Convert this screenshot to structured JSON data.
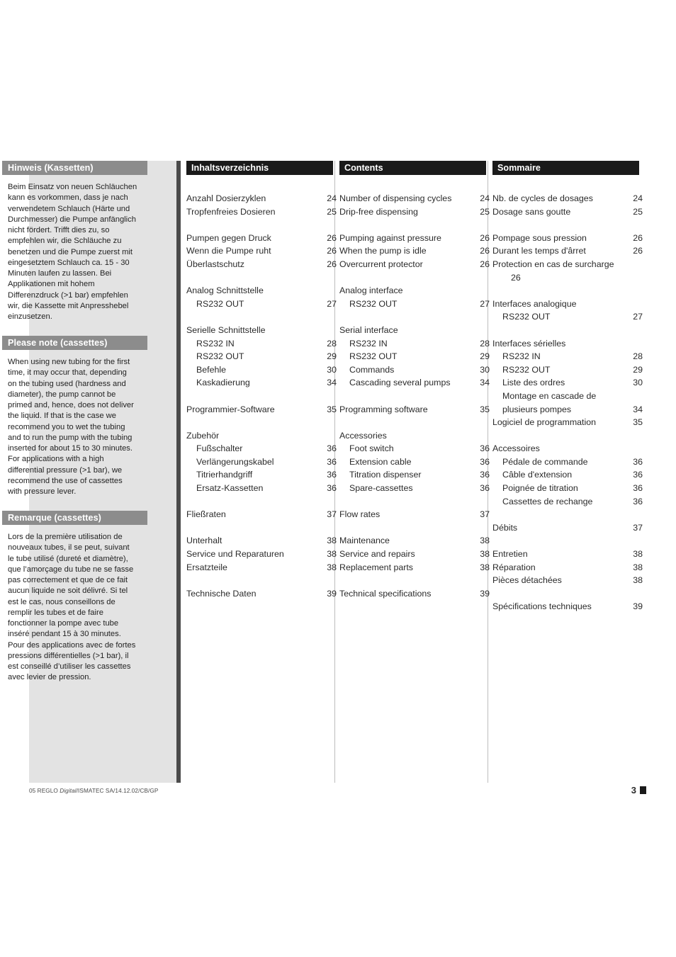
{
  "notes": [
    {
      "heading": "Hinweis (Kassetten)",
      "body": "Beim Einsatz von neuen Schläuchen kann es vorkommen, dass je nach verwendetem Schlauch (Härte und Durchmesser) die Pumpe anfänglich nicht fördert. Trifft dies zu, so empfehlen wir, die Schläuche zu benetzen und die Pumpe zuerst mit eingesetztem Schlauch ca. 15 - 30 Minuten laufen zu lassen. Bei Applikationen mit hohem Differenzdruck (>1 bar) empfehlen wir, die Kassette mit Anpresshebel einzusetzen."
    },
    {
      "heading": "Please note (cassettes)",
      "body": "When using new tubing for the first time, it may occur that, depending on the tubing used (hardness and diameter), the pump cannot be primed and, hence, does not deliver the liquid. If that is the case we recommend you to wet the tubing and to run the pump with the tubing inserted for about 15 to 30 minutes. For applications with a high differential pressure (>1 bar), we recommend the use of cassettes with pressure lever."
    },
    {
      "heading": "Remarque (cassettes)",
      "body": "Lors de la première utilisation de nouveaux tubes, il se peut, suivant le tube utilisé (dureté et diamètre), que l’amorçage du tube ne se fasse pas correctement et que de ce fait aucun liquide ne soit délivré. Si tel est le cas, nous conseillons de remplir les tubes et de faire fonctionner la pompe avec tube inséré pendant 15 à 30 minutes. Pour des applications avec de fortes pressions différentielles (>1 bar), il est conseillé d’utiliser les cassettes avec levier de pression."
    }
  ],
  "toc_de": {
    "heading": "Inhaltsverzeichnis",
    "rows": [
      {
        "label": "Anzahl Dosierzyklen",
        "page": "24",
        "indent": 0
      },
      {
        "label": "Tropfenfreies Dosieren",
        "page": "25",
        "indent": 0
      },
      {
        "gap": true
      },
      {
        "label": "Pumpen gegen Druck",
        "page": "26",
        "indent": 0
      },
      {
        "label": "Wenn die Pumpe ruht",
        "page": "26",
        "indent": 0
      },
      {
        "label": "Überlastschutz",
        "page": "26",
        "indent": 0
      },
      {
        "gap": true
      },
      {
        "label": "Analog Schnittstelle",
        "page": "",
        "indent": 0
      },
      {
        "label": "RS232 OUT",
        "page": "27",
        "indent": 1
      },
      {
        "gap": true
      },
      {
        "label": "Serielle Schnittstelle",
        "page": "",
        "indent": 0
      },
      {
        "label": "RS232 IN",
        "page": "28",
        "indent": 1
      },
      {
        "label": "RS232 OUT",
        "page": "29",
        "indent": 1
      },
      {
        "label": "Befehle",
        "page": "30",
        "indent": 1
      },
      {
        "label": "Kaskadierung",
        "page": "34",
        "indent": 1
      },
      {
        "gap": true
      },
      {
        "label": "Programmier-Software",
        "page": "35",
        "indent": 0
      },
      {
        "gap": true
      },
      {
        "label": "Zubehör",
        "page": "",
        "indent": 0
      },
      {
        "label": "Fußschalter",
        "page": "36",
        "indent": 1
      },
      {
        "label": "Verlängerungskabel",
        "page": "36",
        "indent": 1
      },
      {
        "label": "Titrierhandgriff",
        "page": "36",
        "indent": 1
      },
      {
        "label": "Ersatz-Kassetten",
        "page": "36",
        "indent": 1
      },
      {
        "gap": true
      },
      {
        "label": "Fließraten",
        "page": "37",
        "indent": 0
      },
      {
        "gap": true
      },
      {
        "label": "Unterhalt",
        "page": "38",
        "indent": 0
      },
      {
        "label": "Service und Reparaturen",
        "page": "38",
        "indent": 0
      },
      {
        "label": "Ersatzteile",
        "page": "38",
        "indent": 0
      },
      {
        "gap": true
      },
      {
        "label": "Technische Daten",
        "page": "39",
        "indent": 0
      }
    ]
  },
  "toc_en": {
    "heading": "Contents",
    "rows": [
      {
        "label": "Number of dispensing cycles",
        "page": "24",
        "indent": 0
      },
      {
        "label": "Drip-free dispensing",
        "page": "25",
        "indent": 0
      },
      {
        "gap": true
      },
      {
        "label": "Pumping against pressure",
        "page": "26",
        "indent": 0
      },
      {
        "label": "When the pump is idle",
        "page": "26",
        "indent": 0
      },
      {
        "label": "Overcurrent protector",
        "page": "26",
        "indent": 0
      },
      {
        "gap": true
      },
      {
        "label": "Analog interface",
        "page": "",
        "indent": 0
      },
      {
        "label": "RS232 OUT",
        "page": "27",
        "indent": 1
      },
      {
        "gap": true
      },
      {
        "label": "Serial interface",
        "page": "",
        "indent": 0
      },
      {
        "label": "RS232 IN",
        "page": "28",
        "indent": 1
      },
      {
        "label": "RS232 OUT",
        "page": "29",
        "indent": 1
      },
      {
        "label": "Commands",
        "page": "30",
        "indent": 1
      },
      {
        "label": "Cascading several pumps",
        "page": "34",
        "indent": 1
      },
      {
        "gap": true
      },
      {
        "label": "Programming software",
        "page": "35",
        "indent": 0
      },
      {
        "gap": true
      },
      {
        "label": "Accessories",
        "page": "",
        "indent": 0
      },
      {
        "label": "Foot switch",
        "page": "36",
        "indent": 1
      },
      {
        "label": "Extension cable",
        "page": "36",
        "indent": 1
      },
      {
        "label": "Titration dispenser",
        "page": "36",
        "indent": 1
      },
      {
        "label": "Spare-cassettes",
        "page": "36",
        "indent": 1
      },
      {
        "gap": true
      },
      {
        "label": "Flow rates",
        "page": "37",
        "indent": 0
      },
      {
        "gap": true
      },
      {
        "label": "Maintenance",
        "page": "38",
        "indent": 0
      },
      {
        "label": "Service and repairs",
        "page": "38",
        "indent": 0
      },
      {
        "label": "Replacement parts",
        "page": "38",
        "indent": 0
      },
      {
        "gap": true
      },
      {
        "label": "Technical specifications",
        "page": "39",
        "indent": 0
      }
    ]
  },
  "toc_fr": {
    "heading": "Sommaire",
    "rows": [
      {
        "label": "Nb. de cycles de dosages",
        "page": "24",
        "indent": 0
      },
      {
        "label": "Dosage sans goutte",
        "page": "25",
        "indent": 0
      },
      {
        "gap": true
      },
      {
        "label": "Pompage sous pression",
        "page": "26",
        "indent": 0
      },
      {
        "label": "Durant les temps d'ârret",
        "page": "26",
        "indent": 0
      },
      {
        "label": "Protection en cas  de surcharge",
        "page": "",
        "indent": 0
      },
      {
        "label": "26",
        "page": "",
        "indent": 2
      },
      {
        "gap": true
      },
      {
        "label": "Interfaces analogique",
        "page": "",
        "indent": 0
      },
      {
        "label": "RS232 OUT",
        "page": "27",
        "indent": 1
      },
      {
        "gap": true
      },
      {
        "label": "Interfaces sérielles",
        "page": "",
        "indent": 0
      },
      {
        "label": "RS232 IN",
        "page": "28",
        "indent": 1
      },
      {
        "label": "RS232 OUT",
        "page": "29",
        "indent": 1
      },
      {
        "label": "Liste des ordres",
        "page": "30",
        "indent": 1
      },
      {
        "label": "Montage en cascade de",
        "page": "",
        "indent": 1
      },
      {
        "label": "plusieurs pompes",
        "page": "34",
        "indent": 1
      },
      {
        "label": "Logiciel de programmation",
        "page": "35",
        "indent": 0
      },
      {
        "gap": true
      },
      {
        "label": "Accessoires",
        "page": "",
        "indent": 0
      },
      {
        "label": "Pédale de commande",
        "page": "36",
        "indent": 1
      },
      {
        "label": "Câble d'extension",
        "page": "36",
        "indent": 1
      },
      {
        "label": "Poignée de titration",
        "page": "36",
        "indent": 1
      },
      {
        "label": "Cassettes de rechange",
        "page": "36",
        "indent": 1
      },
      {
        "gap": true
      },
      {
        "label": "Débits",
        "page": "37",
        "indent": 0
      },
      {
        "gap": true
      },
      {
        "label": "Entretien",
        "page": "38",
        "indent": 0
      },
      {
        "label": "Réparation",
        "page": "38",
        "indent": 0
      },
      {
        "label": "Pièces détachées",
        "page": "38",
        "indent": 0
      },
      {
        "gap": true
      },
      {
        "label": "Spécifications techniques",
        "page": "39",
        "indent": 0
      }
    ]
  },
  "footer": {
    "doc_id_prefix": "05 REGLO ",
    "doc_id_italic": "Digital",
    "doc_id_suffix": "/ISMATEC SA/14.12.02/CB/GP",
    "page_number": "3"
  }
}
